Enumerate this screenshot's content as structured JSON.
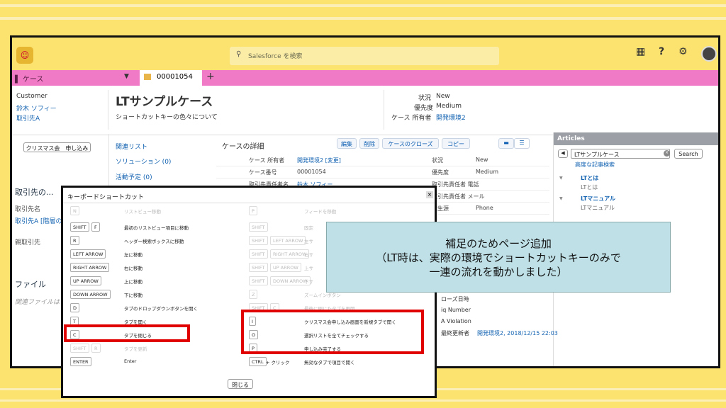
{
  "topbar": {
    "search_placeholder": "Salesforce を検索"
  },
  "tabs": {
    "object_tab": "ケース",
    "record_tab": "00001054"
  },
  "header": {
    "customer_label": "Customer",
    "customer_name": "鈴木 ソフィー",
    "account": "取引先A",
    "title": "LTサンプルケース",
    "subtitle": "ショートカットキーの色々について",
    "status_label": "状況",
    "status_value": "New",
    "priority_label": "優先度",
    "priority_value": "Medium",
    "owner_label": "ケース 所有者",
    "owner_value": "開発環境2"
  },
  "left": {
    "xmas_button": "クリスマス会　申し込み",
    "account_section": "取引先の...",
    "account_name_label": "取引先名",
    "account_name_value": "取引先A [階層の",
    "parent_account_label": "親取引先",
    "files_section": "ファイル",
    "files_empty": "関連ファイルは"
  },
  "related": {
    "title": "関連リスト",
    "items": [
      "ソリューション (0)",
      "活動予定 (0)"
    ]
  },
  "details": {
    "title": "ケースの詳細",
    "actions": [
      "編集",
      "削除",
      "ケースのクローズ",
      "コピー"
    ],
    "rows": [
      {
        "label": "ケース 所有者",
        "value": "開発環境2 [変更]",
        "label2": "状況",
        "value2": "New"
      },
      {
        "label": "ケース番号",
        "value": "00001054",
        "label2": "優先度",
        "value2": "Medium"
      },
      {
        "label": "取引先責任者名",
        "value": "鈴木 ソフィー",
        "label2": "取引先責任者 電話",
        "value2": ""
      },
      {
        "label": "",
        "value": "",
        "label2": "取引先責任者 メール",
        "value2": ""
      },
      {
        "label": "",
        "value": "",
        "label2": "発生源",
        "value2": "Phone"
      }
    ],
    "lower_fragments": [
      "ローズ日時",
      "iq Number",
      "A Violation",
      "最終更新者",
      "開発環境2, 2018/12/15 22:03"
    ]
  },
  "articles": {
    "title": "Articles",
    "search_value": "LTサンプルケース",
    "search_button": "Search",
    "advanced_link": "高度な記事検索",
    "items": [
      {
        "title": "LTとは",
        "sub": "LTとは"
      },
      {
        "title": "LTマニュアル",
        "sub": "LTマニュアル"
      }
    ]
  },
  "shortcuts": {
    "title": "キーボードショートカット",
    "close_button": "閉じる",
    "left": [
      {
        "keys": [
          "N"
        ],
        "desc": "リストビュー移動",
        "dim": true
      },
      {
        "keys": [
          "SHIFT",
          "F"
        ],
        "desc": "最初のリストビュー項目に移動"
      },
      {
        "keys": [
          "R"
        ],
        "desc": "ヘッダー検索ボックスに移動"
      },
      {
        "keys": [
          "LEFT ARROW"
        ],
        "desc": "左に移動"
      },
      {
        "keys": [
          "RIGHT ARROW"
        ],
        "desc": "右に移動"
      },
      {
        "keys": [
          "UP ARROW"
        ],
        "desc": "上に移動"
      },
      {
        "keys": [
          "DOWN ARROW"
        ],
        "desc": "下に移動"
      },
      {
        "keys": [
          "D"
        ],
        "desc": "タブのドロップダウンボタンを開く"
      },
      {
        "keys": [
          "T"
        ],
        "desc": "タブを開く"
      },
      {
        "keys": [
          "C"
        ],
        "desc": "タブを閉じる"
      },
      {
        "keys": [
          "SHIFT",
          "R"
        ],
        "desc": "タブを更新",
        "dim": true
      },
      {
        "keys": [
          "ENTER"
        ],
        "desc": "Enter"
      }
    ],
    "right": [
      {
        "keys": [
          "P"
        ],
        "desc": "フィードを移動",
        "dim": true
      },
      {
        "keys": [
          "SHIFT"
        ],
        "desc": "固定",
        "dim": true
      },
      {
        "keys": [
          "SHIFT",
          "LEFT ARROW"
        ],
        "desc": "左サ",
        "dim": true
      },
      {
        "keys": [
          "SHIFT",
          "RIGHT ARROW"
        ],
        "desc": "右サ",
        "dim": true
      },
      {
        "keys": [
          "SHIFT",
          "UP ARROW"
        ],
        "desc": "上サ",
        "dim": true
      },
      {
        "keys": [
          "SHIFT",
          "DOWN ARROW"
        ],
        "desc": "下サ",
        "dim": true
      },
      {
        "keys": [
          "Z"
        ],
        "desc": "ズームインボタン",
        "dim": true
      },
      {
        "keys": [
          "SHIFT",
          "C"
        ],
        "desc": "最後に閉じたタブを再開",
        "dim": true
      },
      {
        "keys": [
          "I"
        ],
        "desc": "クリスマス会申し込み画面を新規タブで開く"
      },
      {
        "keys": [
          "O"
        ],
        "desc": "選択リストを全てチェックする"
      },
      {
        "keys": [
          "P"
        ],
        "desc": "申し込み完了する"
      },
      {
        "keys": [
          "CTRL",
          "+ クリック"
        ],
        "desc": "無効なタブで項目で開く"
      }
    ]
  },
  "note": {
    "lines": [
      "補足のためページ追加",
      "（LT時は、実際の環境でショートカットキーのみで",
      "一連の流れを動かしました）"
    ]
  },
  "colors": {
    "background": "#fce26e",
    "tab_bar": "#f07ac6",
    "highlight": "#e00000",
    "note_bg": "#bee0e6"
  }
}
